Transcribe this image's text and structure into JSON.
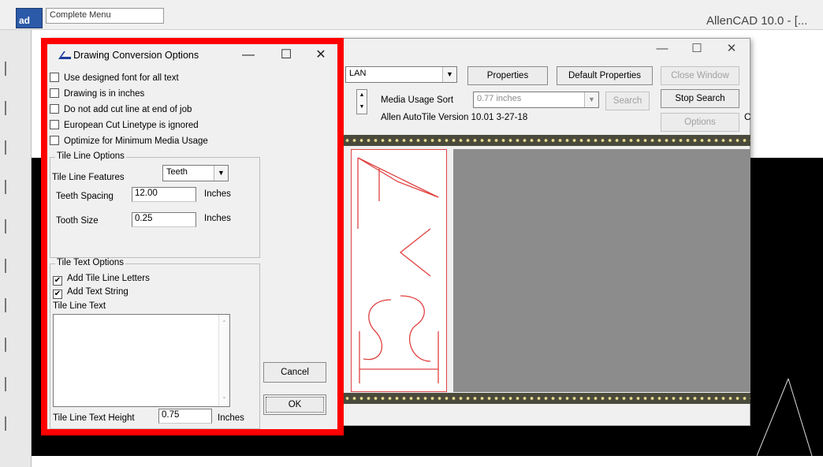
{
  "background_app": {
    "menu_select": "Complete Menu",
    "title": "AllenCAD 10.0 - [...",
    "logo": "ad"
  },
  "autotile": {
    "controls": {
      "minimize": "—",
      "maximize": "☐",
      "close": "✕"
    },
    "device_select": "LAN",
    "buttons": {
      "properties": "Properties",
      "default_properties": "Default Properties",
      "close_window": "Close Window",
      "search": "Search",
      "stop_search": "Stop Search",
      "options": "Options"
    },
    "media_usage_sort_label": "Media Usage Sort",
    "media_usage_sort_value": "0.77 inches",
    "version": "Allen AutoTile Version 10.01 3-27-18",
    "truncated_label": "C"
  },
  "dialog": {
    "title": "Drawing Conversion Options",
    "controls": {
      "minimize": "—",
      "maximize": "☐",
      "close": "✕"
    },
    "checkboxes": [
      {
        "label": "Use designed font for all text",
        "checked": false
      },
      {
        "label": "Drawing is in inches",
        "checked": false
      },
      {
        "label": "Do not add cut line at end of job",
        "checked": false
      },
      {
        "label": "European Cut Linetype is ignored",
        "checked": false
      },
      {
        "label": "Optimize for Minimum Media Usage",
        "checked": false
      }
    ],
    "tile_line_options": {
      "group_title": "Tile Line Options",
      "features_label": "Tile Line Features",
      "features_value": "Teeth",
      "teeth_spacing_label": "Teeth Spacing",
      "teeth_spacing_value": "12.00",
      "tooth_size_label": "Tooth Size",
      "tooth_size_value": "0.25",
      "unit": "Inches"
    },
    "tile_text_options": {
      "group_title": "Tile Text Options",
      "add_letters_label": "Add Tile Line Letters",
      "add_letters_checked": true,
      "add_string_label": "Add Text String",
      "add_string_checked": true,
      "text_label": "Tile Line Text",
      "text_value": "",
      "height_label": "Tile Line Text Height",
      "height_value": "0.75",
      "unit": "Inches"
    },
    "buttons": {
      "cancel": "Cancel",
      "ok": "OK"
    }
  },
  "icons": [
    "allen-logo-icon",
    "dropdown-arrow-icon",
    "spin-up-icon",
    "spin-down-icon",
    "checkmark-icon"
  ]
}
